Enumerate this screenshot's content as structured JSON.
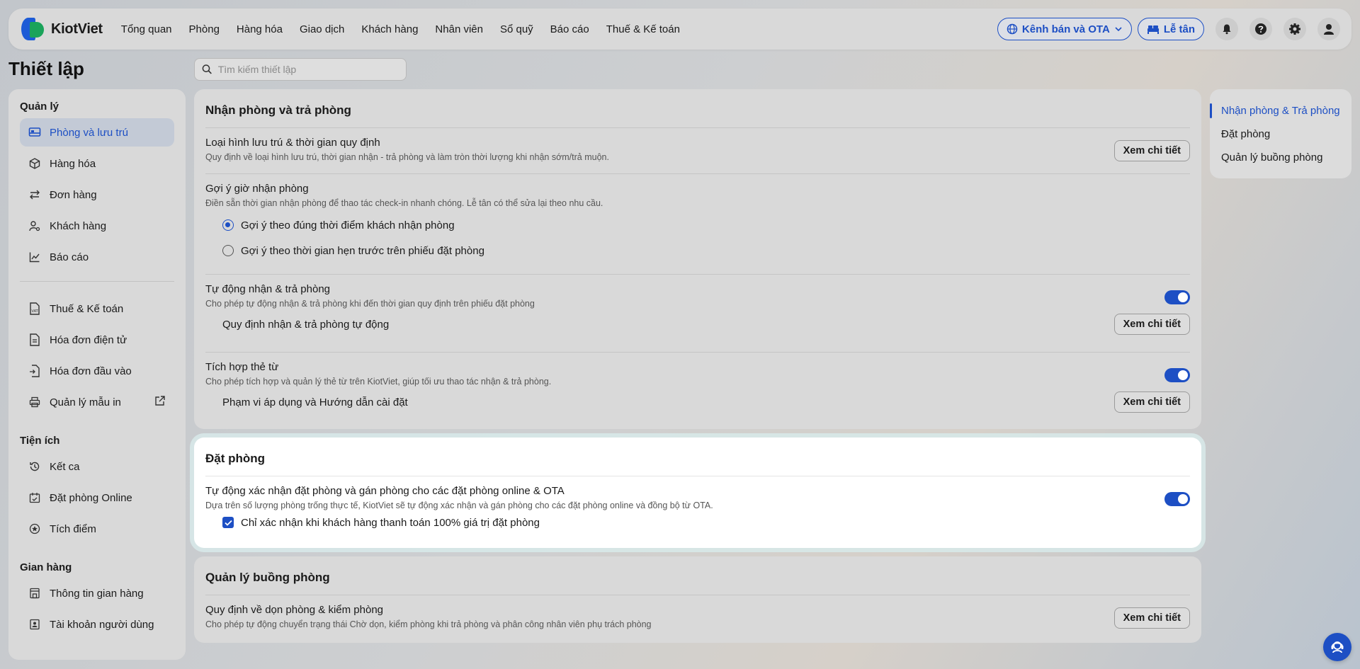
{
  "brand": {
    "name": "KiotViet"
  },
  "nav": [
    "Tổng quan",
    "Phòng",
    "Hàng hóa",
    "Giao dịch",
    "Khách hàng",
    "Nhân viên",
    "Sổ quỹ",
    "Báo cáo",
    "Thuế & Kế toán"
  ],
  "topbar": {
    "channel_label": "Kênh bán và OTA",
    "reception_label": "Lễ tân"
  },
  "page": {
    "title": "Thiết lập"
  },
  "search": {
    "placeholder": "Tìm kiếm thiết lập"
  },
  "sidebar": {
    "groups": [
      {
        "label": "Quản lý",
        "items": [
          "Phòng và lưu trú",
          "Hàng hóa",
          "Đơn hàng",
          "Khách hàng",
          "Báo cáo"
        ]
      },
      {
        "items": [
          "Thuế & Kế toán",
          "Hóa đơn điện tử",
          "Hóa đơn đầu vào",
          "Quản lý mẫu in"
        ]
      },
      {
        "label": "Tiện ích",
        "items": [
          "Kết ca",
          "Đặt phòng Online",
          "Tích điểm"
        ]
      },
      {
        "label": "Gian hàng",
        "items": [
          "Thông tin gian hàng",
          "Tài khoản người dùng"
        ]
      }
    ]
  },
  "sections": {
    "checkin": {
      "title": "Nhận phòng và trả phòng",
      "stay_type": {
        "title": "Loại hình lưu trú & thời gian quy định",
        "desc": "Quy định về loại hình lưu trú, thời gian nhận - trả phòng và làm tròn thời lượng khi nhận sớm/trả muộn."
      },
      "suggest": {
        "title": "Gợi ý giờ nhận phòng",
        "desc": "Điền sẵn thời gian nhận phòng để thao tác check-in nhanh chóng. Lễ tân có thể sửa lại theo nhu cầu.",
        "option1": "Gợi ý theo đúng thời điểm khách nhận phòng",
        "option2": "Gợi ý theo thời gian hẹn trước trên phiếu đặt phòng",
        "selected": 1
      },
      "auto": {
        "title": "Tự động nhận & trả phòng",
        "desc": "Cho phép tự động nhận & trả phòng khi đến thời gian quy định trên phiếu đặt phòng",
        "enabled": true,
        "sub": "Quy định nhận & trả phòng tự động"
      },
      "card": {
        "title": "Tích hợp thẻ từ",
        "desc": "Cho phép tích hợp và quản lý thẻ từ trên KiotViet, giúp tối ưu thao tác nhận & trả phòng.",
        "enabled": true,
        "sub": "Phạm vi áp dụng và Hướng dẫn cài đặt"
      }
    },
    "booking": {
      "title": "Đặt phòng",
      "auto_confirm": {
        "title": "Tự động xác nhận đặt phòng và gán phòng cho các đặt phòng online & OTA",
        "desc": "Dựa trên số lượng phòng trống thực tế, KiotViet sẽ tự động xác nhận và gán phòng cho các đặt phòng online và đồng bộ từ OTA.",
        "enabled": true,
        "checkbox": "Chỉ xác nhận khi khách hàng thanh toán 100% giá trị đặt phòng",
        "checked": true
      }
    },
    "housekeeping": {
      "title": "Quản lý buồng phòng",
      "rule": {
        "title": "Quy định về dọn phòng & kiểm phòng",
        "desc": "Cho phép tự động chuyển trạng thái Chờ dọn, kiểm phòng khi trả phòng và phân công nhân viên phụ trách phòng"
      }
    }
  },
  "detail_label": "Xem chi tiết",
  "anchors": [
    "Nhận phòng & Trả phòng",
    "Đặt phòng",
    "Quản lý buồng phòng"
  ],
  "colors": {
    "accent": "#1d4fc4",
    "brand_green": "#1aa35a"
  }
}
